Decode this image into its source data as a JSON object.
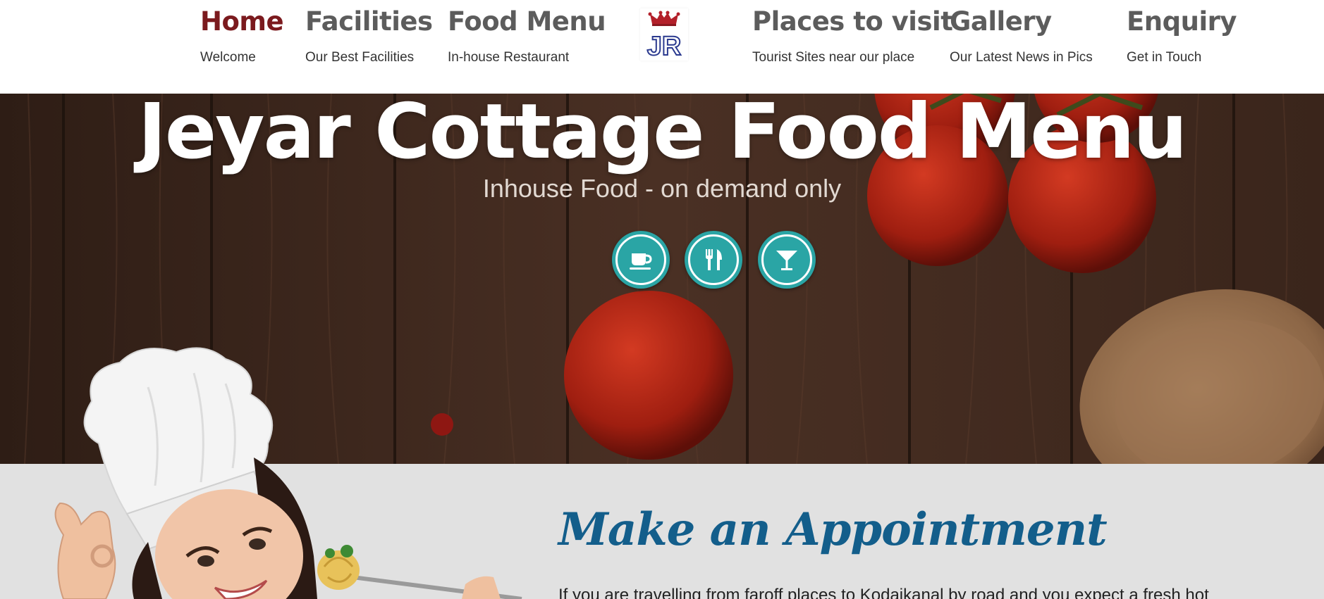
{
  "nav": {
    "items": [
      {
        "title": "Home",
        "subtitle": "Welcome",
        "active": true
      },
      {
        "title": "Facilities",
        "subtitle": "Our Best Facilities",
        "active": false
      },
      {
        "title": "Food Menu",
        "subtitle": "In-house Restaurant",
        "active": false
      },
      {
        "title": "Places to visit",
        "subtitle": "Tourist Sites near our place",
        "active": false
      },
      {
        "title": "Gallery",
        "subtitle": "Our Latest News in Pics",
        "active": false
      },
      {
        "title": "Enquiry",
        "subtitle": "Get in Touch",
        "active": false
      }
    ],
    "logo_text": "JR"
  },
  "hero": {
    "title": "Jeyar Cottage Food Menu",
    "subtitle": "Inhouse Food - on demand only",
    "buttons": [
      {
        "icon": "coffee-cup-icon"
      },
      {
        "icon": "fork-knife-icon"
      },
      {
        "icon": "cocktail-glass-icon"
      }
    ]
  },
  "appointment": {
    "title": "Make an Appointment",
    "text": "If you are travelling from faroff places to Kodaikanal by road and you expect a fresh hot"
  },
  "colors": {
    "active_nav": "#7b1a1e",
    "nav_text": "#5c5c5c",
    "teal": "#2aa5a5",
    "appointment_title": "#135e8b",
    "lower_bg": "#e1e1e1"
  }
}
